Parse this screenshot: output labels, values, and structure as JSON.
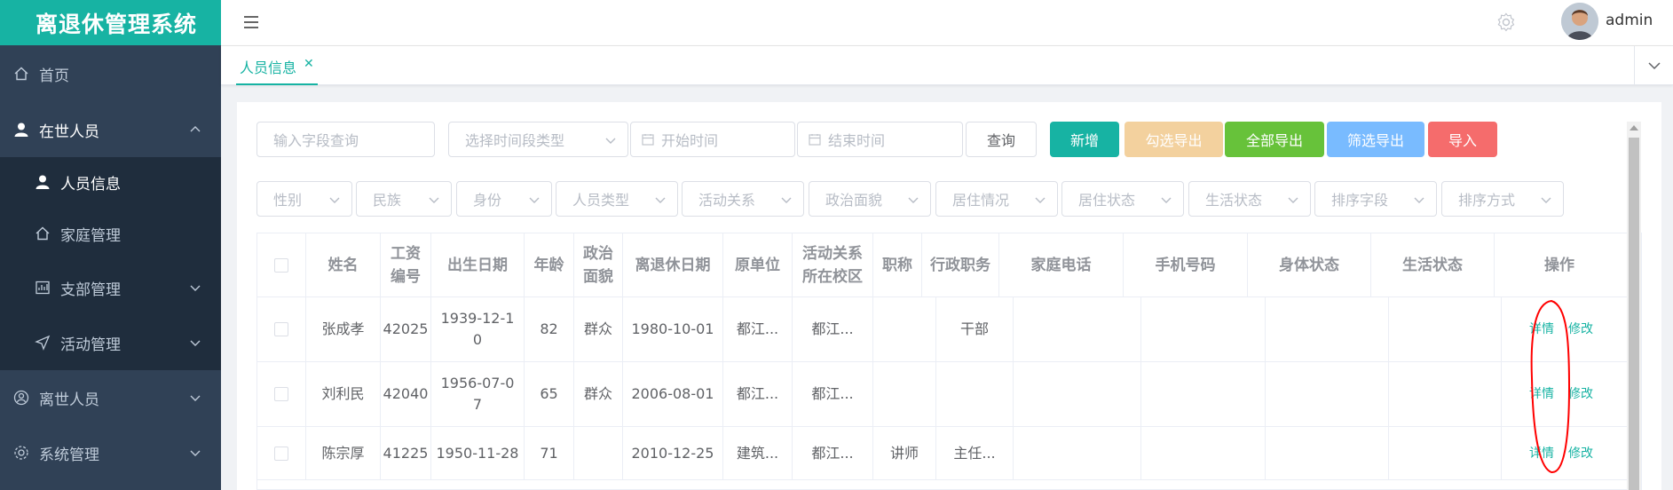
{
  "app": {
    "title": "离退休管理系统",
    "username": "admin"
  },
  "colors": {
    "accent": "#17b3a3",
    "sidebar": "#304156",
    "success": "#67c23a",
    "warning": "#f3d19e",
    "info": "#79bbff",
    "danger": "#f56c6c"
  },
  "sidebar": {
    "home": "首页",
    "living": "在世人员",
    "living_children": [
      "人员信息",
      "家庭管理",
      "支部管理",
      "活动管理"
    ],
    "deceased": "离世人员",
    "system": "系统管理"
  },
  "tags": {
    "active": "人员信息"
  },
  "filters": {
    "keyword_placeholder": "输入字段查询",
    "time_type": "选择时间段类型",
    "start": "开始时间",
    "end": "结束时间",
    "query": "查询",
    "selects": [
      "性别",
      "民族",
      "身份",
      "人员类型",
      "活动关系",
      "政治面貌",
      "居住情况",
      "居住状态",
      "生活状态",
      "排序字段",
      "排序方式"
    ]
  },
  "buttons": {
    "add": "新增",
    "export_checked": "勾选导出",
    "export_all": "全部导出",
    "export_filtered": "筛选导出",
    "import": "导入"
  },
  "table": {
    "headers": [
      "姓名",
      "工资\n编号",
      "出生日期",
      "年龄",
      "政治\n面貌",
      "离退休日期",
      "原单位",
      "活动关系\n所在校区",
      "职称",
      "行政职务",
      "家庭电话",
      "手机号码",
      "身体状态",
      "生活状态",
      "操作"
    ],
    "detail": "详情",
    "edit": "修改",
    "rows": [
      [
        "张成孝",
        "42025",
        "1939-12-1\n0",
        "82",
        "群众",
        "1980-10-01",
        "都江...",
        "都江...",
        "",
        "干部",
        "",
        "",
        "",
        ""
      ],
      [
        "刘利民",
        "42040",
        "1956-07-0\n7",
        "65",
        "群众",
        "2006-08-01",
        "都江...",
        "都江...",
        "",
        "",
        "",
        "",
        "",
        ""
      ],
      [
        "陈宗厚",
        "41225",
        "1950-11-28",
        "71",
        "",
        "2010-12-25",
        "建筑...",
        "都江...",
        "讲师",
        "主任...",
        "",
        "",
        "",
        ""
      ]
    ]
  }
}
